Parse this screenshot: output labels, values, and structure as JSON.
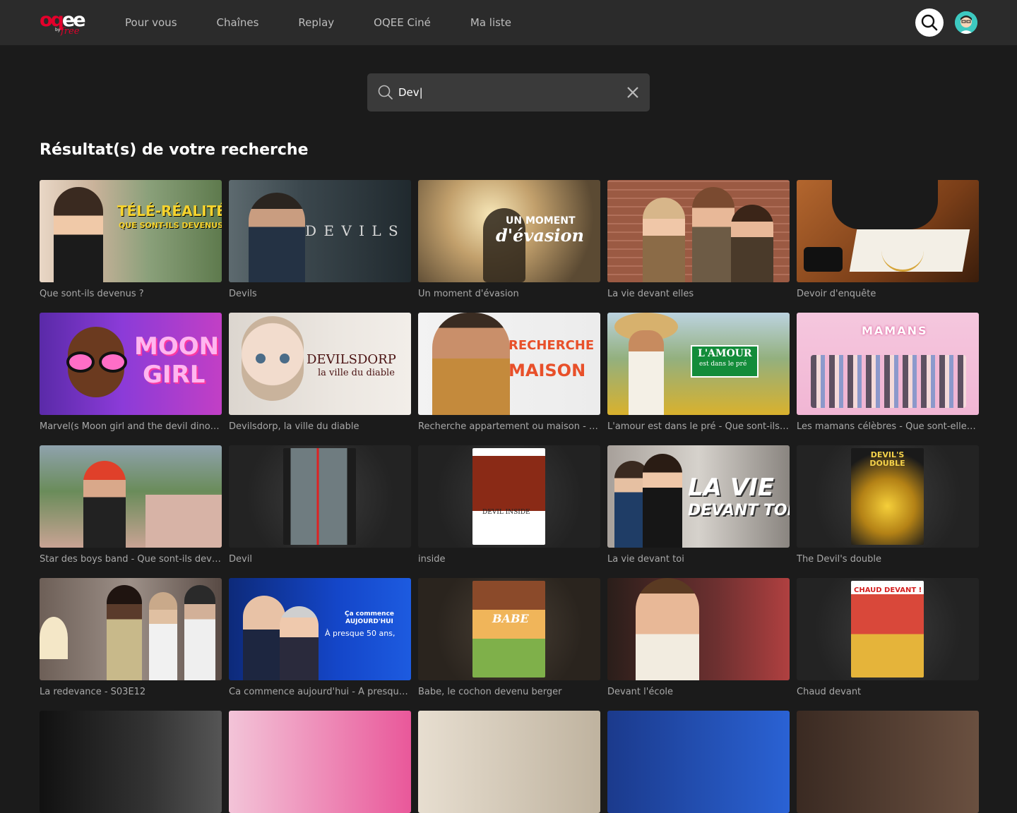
{
  "header": {
    "logo": {
      "main_a": "oq",
      "main_b": "ee",
      "by": "by",
      "free": "free"
    },
    "nav": [
      "Pour vous",
      "Chaînes",
      "Replay",
      "OQEE Ciné",
      "Ma liste"
    ]
  },
  "search": {
    "value": "Dev|"
  },
  "results_title": "Résultat(s) de votre recherche",
  "results": [
    {
      "title": "Que sont-ils devenus ?",
      "overlay": "TÉLÉ-RÉALITÉ",
      "overlay2": "QUE SONT-ILS DEVENUS"
    },
    {
      "title": "Devils",
      "overlay": "D E V I L S"
    },
    {
      "title": "Un moment d'évasion",
      "overlay": "UN MOMENT",
      "overlay2": "d'évasion"
    },
    {
      "title": "La vie devant elles"
    },
    {
      "title": "Devoir d'enquête"
    },
    {
      "title": "Marvel(s Moon girl and the devil dinosa...",
      "overlay": "MOON",
      "overlay2": "GIRL"
    },
    {
      "title": "Devilsdorp, la ville du diable",
      "overlay": "DEVILSDORP",
      "overlay2": "la ville du diable"
    },
    {
      "title": "Recherche appartement ou maison - Q...",
      "overlay": "RECHERCHE",
      "overlay2": "MAISON"
    },
    {
      "title": "L'amour est dans le pré - Que sont-ils d...",
      "overlay": "L'AMOUR",
      "overlay2": "est dans le pré"
    },
    {
      "title": "Les mamans célèbres - Que sont-elles ...",
      "overlay": "MAMANS"
    },
    {
      "title": "Star des boys band - Que sont-ils deve..."
    },
    {
      "title": "Devil"
    },
    {
      "title": "inside",
      "overlay": "DEVIL INSIDE"
    },
    {
      "title": "La vie devant toi",
      "overlay": "LA VIE",
      "overlay2": "DEVANT TOI"
    },
    {
      "title": "The Devil's double",
      "overlay": "DEVIL'S DOUBLE"
    },
    {
      "title": "La redevance - S03E12"
    },
    {
      "title": "Ca commence aujourd'hui - À presque...",
      "overlay": "Ça commence AUJOURD'HUI",
      "overlay2": "À presque 50 ans,"
    },
    {
      "title": "Babe, le cochon devenu berger",
      "overlay": "BABE"
    },
    {
      "title": "Devant l'école"
    },
    {
      "title": "Chaud devant",
      "overlay": "CHAUD DEVANT !"
    }
  ],
  "colors": {
    "brand_red": "#e4002b",
    "topbar": "#2b2b2b",
    "background": "#1b1b1b",
    "searchbox": "#3a3a3a"
  }
}
